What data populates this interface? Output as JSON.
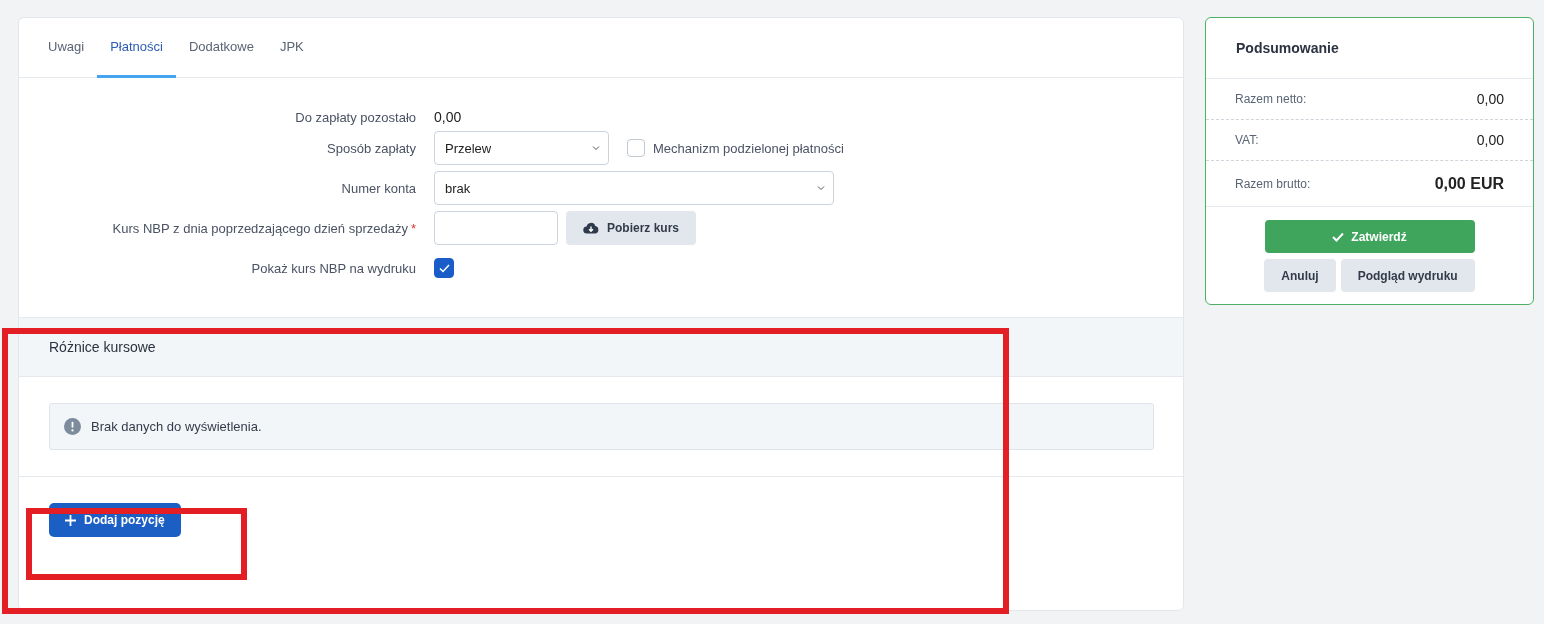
{
  "tabs": [
    {
      "label": "Uwagi",
      "selected": false
    },
    {
      "label": "Płatności",
      "selected": true
    },
    {
      "label": "Dodatkowe",
      "selected": false
    },
    {
      "label": "JPK",
      "selected": false
    }
  ],
  "form": {
    "remaining": {
      "label": "Do zapłaty pozostało",
      "value": "0,00"
    },
    "payment_method": {
      "label": "Sposób zapłaty",
      "value": "Przelew",
      "split_payment": {
        "label": "Mechanizm podzielonej płatności",
        "checked": false
      }
    },
    "account": {
      "label": "Numer konta",
      "value": "brak"
    },
    "rate": {
      "label": "Kurs NBP z dnia poprzedzającego dzień sprzedaży",
      "required_mark": "*",
      "button": "Pobierz kurs"
    },
    "show_rate": {
      "label": "Pokaż kurs NBP na wydruku",
      "checked": true
    }
  },
  "exchange_differences": {
    "title": "Różnice kursowe",
    "empty_message": "Brak danych do wyświetlenia.",
    "add_button": "Dodaj pozycję"
  },
  "summary": {
    "title": "Podsumowanie",
    "rows": [
      {
        "label": "Razem netto:",
        "value": "0,00",
        "kind": "plain"
      },
      {
        "label": "VAT:",
        "value": "0,00",
        "kind": "plain"
      },
      {
        "label": "Razem brutto:",
        "value": "0,00 EUR",
        "kind": "total"
      }
    ],
    "confirm_button": "Zatwierdź",
    "cancel_button": "Anuluj",
    "preview_button": "Podgląd wydruku"
  }
}
